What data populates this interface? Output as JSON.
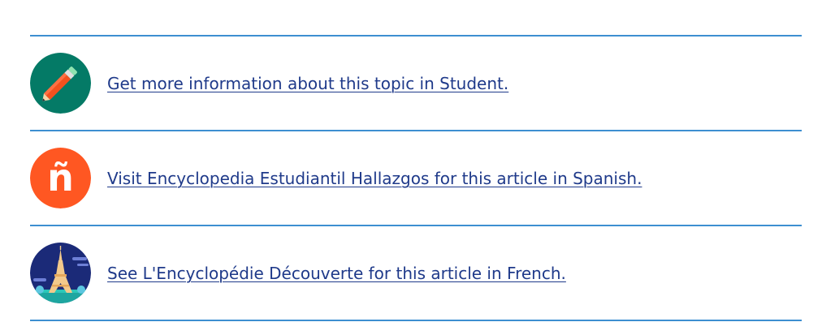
{
  "resources": [
    {
      "icon": "pencil-icon",
      "icon_bg": "#047a66",
      "label": "Get more information about this topic in Student."
    },
    {
      "icon": "enye-icon",
      "icon_bg": "#ff5722",
      "icon_glyph": "ñ",
      "label": "Visit Encyclopedia Estudiantil Hallazgos for this article in Spanish."
    },
    {
      "icon": "eiffel-tower-icon",
      "icon_bg": "#1b2a78",
      "label": "See L'Encyclopédie Découverte for this article in French."
    }
  ],
  "colors": {
    "divider": "#3d8fd1",
    "link": "#1f3a8a"
  }
}
